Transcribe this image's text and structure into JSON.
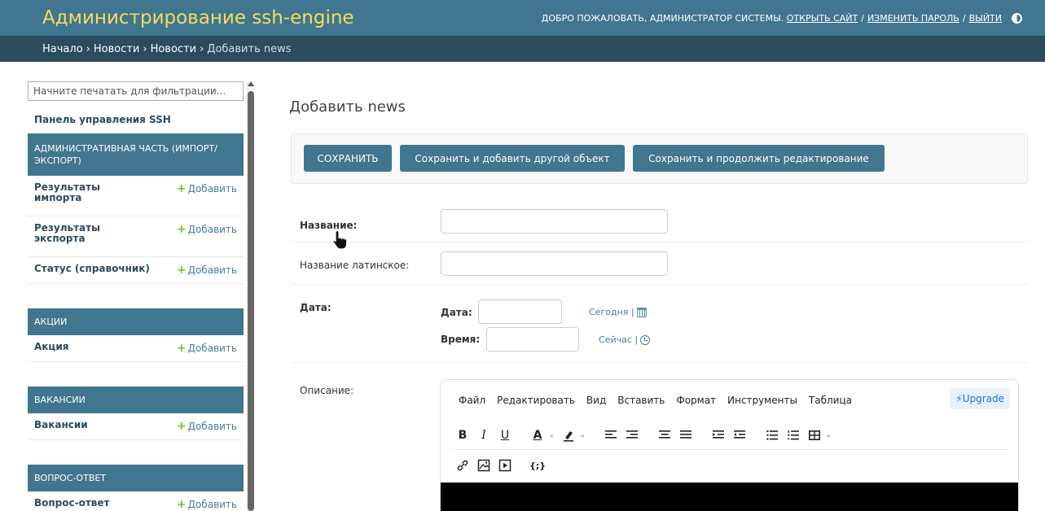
{
  "header": {
    "site_title": "Администрирование ssh-engine",
    "welcome": "Добро пожаловать,",
    "user": "Администратор системы.",
    "open_site": "Открыть сайт",
    "change_password": "Изменить пароль",
    "logout": "Выйти",
    "sep": "/"
  },
  "breadcrumbs": {
    "items": [
      "Начало",
      "Новости",
      "Новости"
    ],
    "current": "Добавить news",
    "sep": "›"
  },
  "sidebar": {
    "filter_placeholder": "Начните печатать для фильтрации...",
    "app_link": "Панель управления SSH",
    "add_label": "Добавить",
    "modules": [
      {
        "caption": "Административная часть (импорт/экспорт)",
        "models": [
          "Результаты импорта",
          "Результаты экспорта",
          "Статус (справочник)"
        ]
      },
      {
        "caption": "Акции",
        "models": [
          "Акция"
        ]
      },
      {
        "caption": "Вакансии",
        "models": [
          "Вакансии"
        ]
      },
      {
        "caption": "Вопрос-ответ",
        "models": [
          "Вопрос-ответ"
        ]
      }
    ]
  },
  "page": {
    "title": "Добавить news",
    "buttons": {
      "save": "СОХРАНИТЬ",
      "save_add": "Сохранить и добавить другой объект",
      "save_continue": "Сохранить и продолжить редактирование"
    },
    "fields": {
      "name": "Название:",
      "name_latin": "Название латинское:",
      "date": "Дата:",
      "date_sub": "Дата:",
      "time_sub": "Время:",
      "today": "Сегодня |",
      "now": "Сейчас |",
      "description": "Описание:"
    }
  },
  "editor": {
    "menus": [
      "Файл",
      "Редактировать",
      "Вид",
      "Вставить",
      "Формат",
      "Инструменты",
      "Таблица"
    ],
    "upgrade": "⚡Upgrade",
    "toolbar1": [
      "B",
      "I",
      "U"
    ],
    "toolbar2_letter": "A",
    "source_code": "{;}"
  },
  "colors": {
    "primary": "#417690",
    "breadcrumb": "#2b4c5e",
    "site_title": "#f5dd5d",
    "add_plus": "#70bf2b"
  }
}
